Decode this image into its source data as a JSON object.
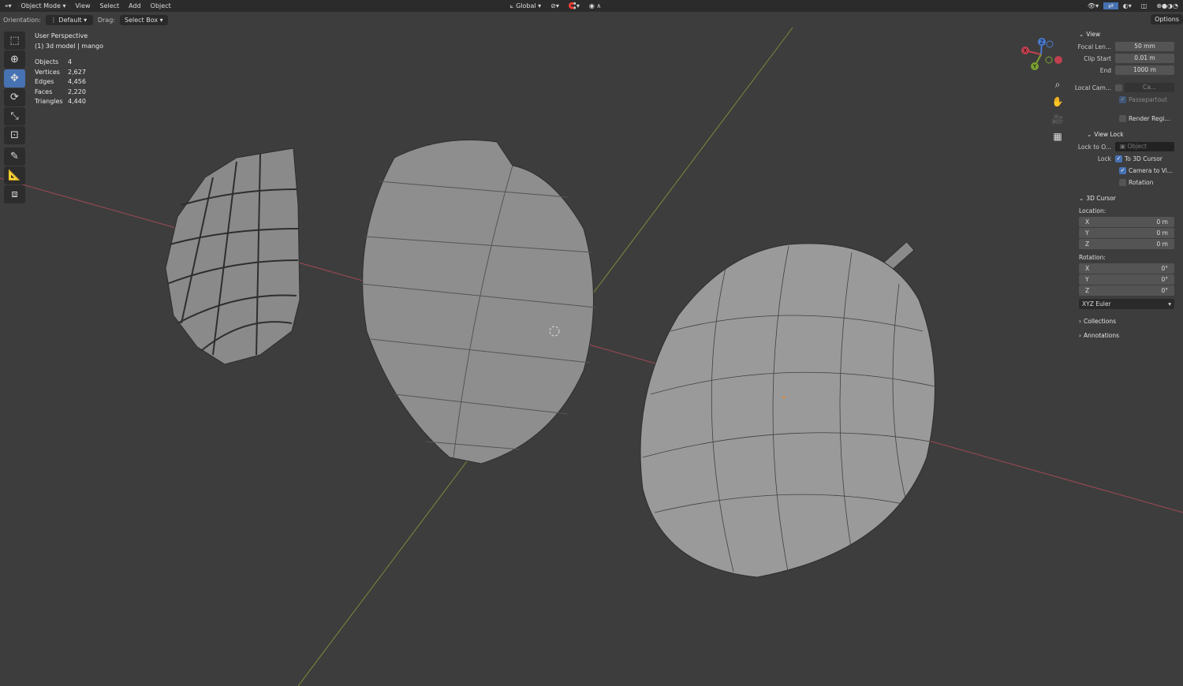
{
  "topbar": {
    "mode": "Object Mode",
    "menus": [
      "View",
      "Select",
      "Add",
      "Object"
    ],
    "transform_orientation": "Global"
  },
  "header": {
    "orientation_label": "Orientation:",
    "orientation_value": "Default",
    "drag_label": "Drag:",
    "drag_value": "Select Box",
    "options": "Options"
  },
  "overlay": {
    "view_name": "User Perspective",
    "object_name": "(1) 3d model | mango",
    "stats": [
      {
        "k": "Objects",
        "v": "4"
      },
      {
        "k": "Vertices",
        "v": "2,627"
      },
      {
        "k": "Edges",
        "v": "4,456"
      },
      {
        "k": "Faces",
        "v": "2,220"
      },
      {
        "k": "Triangles",
        "v": "4,440"
      }
    ]
  },
  "gizmo": {
    "x": "X",
    "y": "Y",
    "z": "Z"
  },
  "panel": {
    "view": {
      "title": "View",
      "focal_label": "Focal Len...",
      "focal": "50 mm",
      "clip_start_label": "Clip Start",
      "clip_start": "0.01 m",
      "end_label": "End",
      "end": "1000 m",
      "local_cam_label": "Local Cam...",
      "local_cam": "Ca...",
      "passepartout": "Passepartout",
      "render_region": "Render Regi..."
    },
    "view_lock": {
      "title": "View Lock",
      "lock_to_label": "Lock to O...",
      "lock_to": "Object",
      "lock_label": "Lock",
      "to_cursor": "To 3D Cursor",
      "camera_to_view": "Camera to Vi...",
      "rotation": "Rotation"
    },
    "cursor": {
      "title": "3D Cursor",
      "location_label": "Location:",
      "location": [
        {
          "a": "X",
          "v": "0 m"
        },
        {
          "a": "Y",
          "v": "0 m"
        },
        {
          "a": "Z",
          "v": "0 m"
        }
      ],
      "rotation_label": "Rotation:",
      "rotation": [
        {
          "a": "X",
          "v": "0°"
        },
        {
          "a": "Y",
          "v": "0°"
        },
        {
          "a": "Z",
          "v": "0°"
        }
      ],
      "rotation_mode": "XYZ Euler"
    },
    "collections": "Collections",
    "annotations": "Annotations"
  }
}
